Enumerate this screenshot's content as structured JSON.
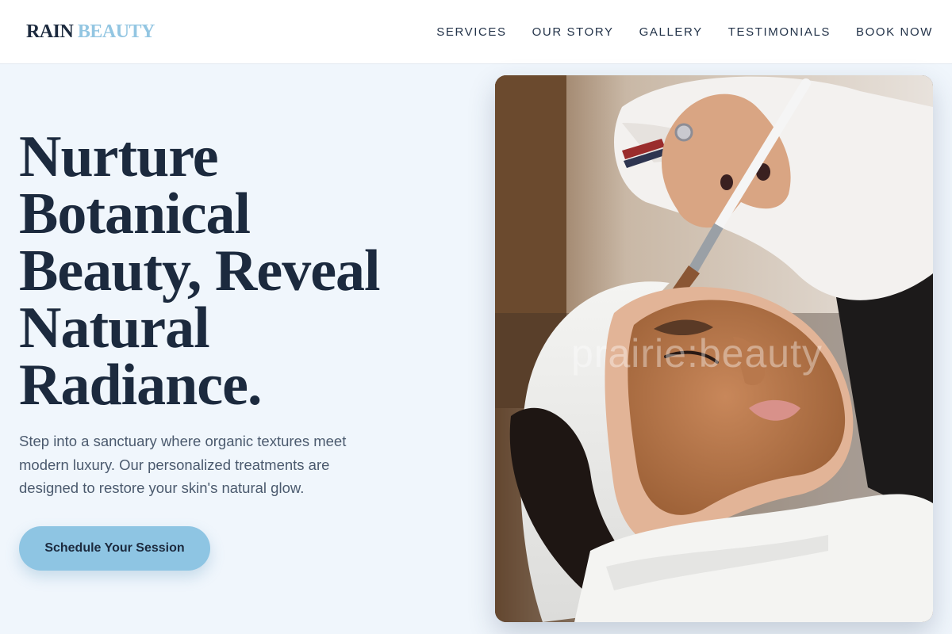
{
  "header": {
    "logo_part1": "RAIN",
    "logo_part2": "BEAUTY",
    "nav": [
      {
        "label": "SERVICES"
      },
      {
        "label": "OUR STORY"
      },
      {
        "label": "GALLERY"
      },
      {
        "label": "TESTIMONIALS"
      },
      {
        "label": "BOOK NOW"
      }
    ]
  },
  "hero": {
    "title_lines": [
      "Nurture",
      "Botanical",
      "Beauty, Reveal",
      "Natural",
      "Radiance."
    ],
    "subtitle": "Step into a sanctuary where organic textures meet modern luxury. Our personalized treatments are designed to restore your skin's natural glow.",
    "cta_label": "Schedule Your Session"
  },
  "photo": {
    "watermark": "prairie:beauty",
    "subject": "woman receiving clay face mask treatment"
  },
  "colors": {
    "background": "#f0f6fc",
    "accent": "#93c6e2",
    "button": "#8ec5e3",
    "text_dark": "#1c2a3e"
  }
}
